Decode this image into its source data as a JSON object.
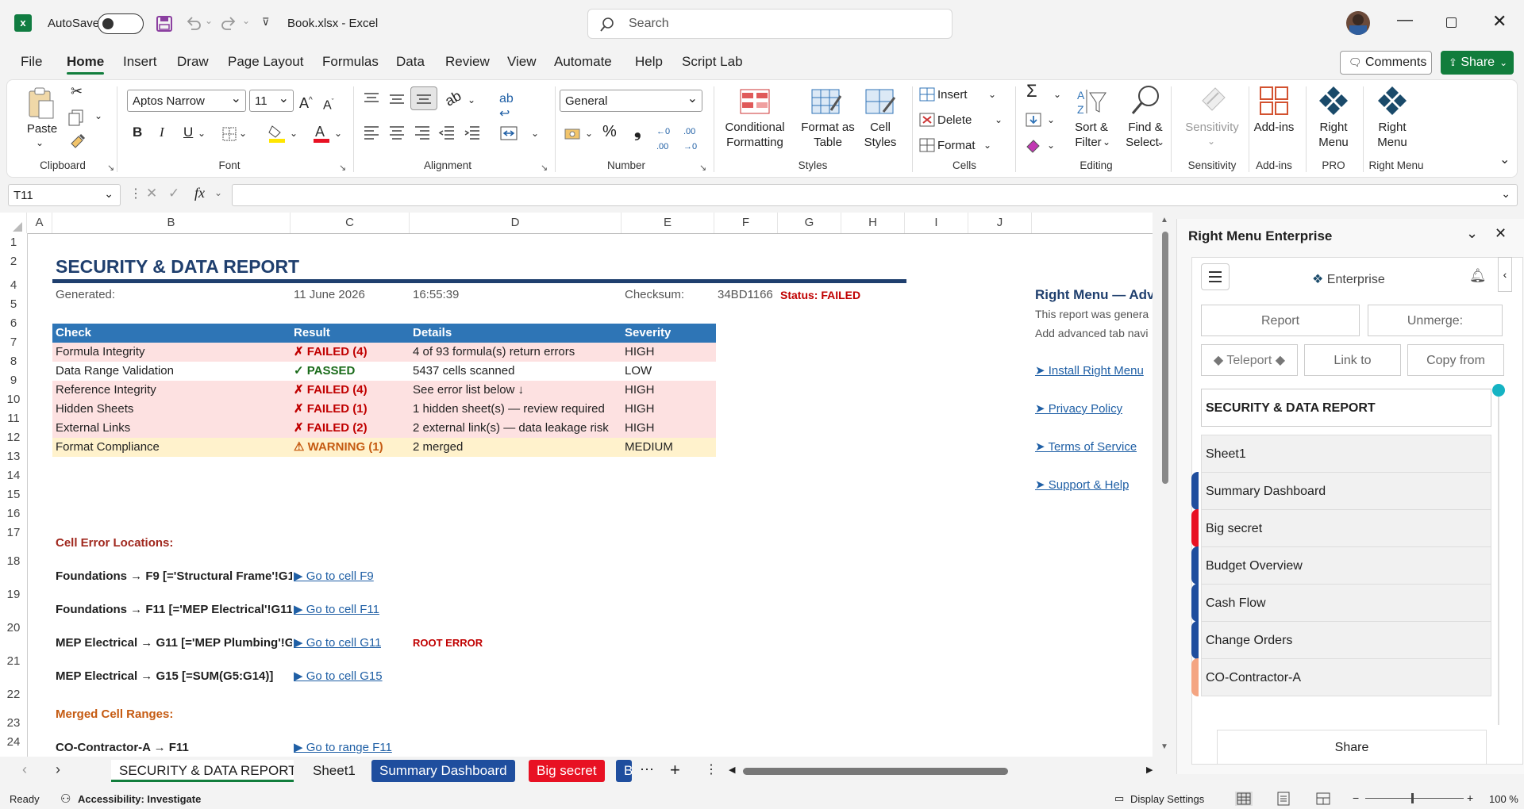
{
  "titlebar": {
    "autosave_label": "AutoSave",
    "autosave_state": "Off",
    "file_title": "Book.xlsx  -  Excel",
    "search_placeholder": "Search"
  },
  "menu_tabs": [
    "File",
    "Home",
    "Insert",
    "Draw",
    "Page Layout",
    "Formulas",
    "Data",
    "Review",
    "View",
    "Automate",
    "Help",
    "Script Lab"
  ],
  "active_tab": "Home",
  "header_buttons": {
    "comments": "Comments",
    "share": "Share"
  },
  "ribbon": {
    "clipboard": {
      "label": "Clipboard",
      "paste": "Paste"
    },
    "font": {
      "label": "Font",
      "font_name": "Aptos Narrow",
      "font_size": "11"
    },
    "alignment": {
      "label": "Alignment"
    },
    "number": {
      "label": "Number",
      "format": "General"
    },
    "styles": {
      "label": "Styles",
      "cond_1": "Conditional",
      "cond_2": "Formatting",
      "fat_1": "Format as",
      "fat_2": "Table",
      "cs_1": "Cell",
      "cs_2": "Styles"
    },
    "cells": {
      "label": "Cells",
      "insert": "Insert",
      "delete": "Delete",
      "format": "Format"
    },
    "editing": {
      "label": "Editing",
      "sort_1": "Sort &",
      "sort_2": "Filter",
      "find_1": "Find &",
      "find_2": "Select"
    },
    "sensitivity": {
      "label": "Sensitivity",
      "btn": "Sensitivity"
    },
    "addins": {
      "label": "Add-ins",
      "btn": "Add-ins"
    },
    "pro": {
      "label": "PRO",
      "btn_1": "Right",
      "btn_2": "Menu"
    },
    "rightmenu": {
      "label": "Right Menu",
      "btn_1": "Right",
      "btn_2": "Menu"
    }
  },
  "formula_bar": {
    "name_box": "T11",
    "formula": ""
  },
  "columns": [
    "A",
    "B",
    "C",
    "D",
    "E",
    "F",
    "G",
    "H",
    "I",
    "J"
  ],
  "rows": [
    "1",
    "2",
    "4",
    "5",
    "6",
    "7",
    "8",
    "9",
    "10",
    "11",
    "12",
    "13",
    "14",
    "15",
    "16",
    "17",
    "18",
    "19",
    "20",
    "21",
    "22",
    "23",
    "24"
  ],
  "report": {
    "title": "SECURITY & DATA REPORT",
    "generated_label": "Generated:",
    "date": "11 June 2026",
    "time": "16:55:39",
    "checksum_label": "Checksum:",
    "checksum": "34BD1166",
    "status": "Status: FAILED",
    "headers": [
      "Check",
      "Result",
      "Details",
      "Severity"
    ],
    "table": [
      {
        "check": "Formula Integrity",
        "result": "✗ FAILED (4)",
        "details": "4 of 93 formula(s) return errors",
        "severity": "HIGH"
      },
      {
        "check": "Data Range Validation",
        "result": "✓ PASSED",
        "details": "5437 cells scanned",
        "severity": "LOW"
      },
      {
        "check": "Reference Integrity",
        "result": "✗ FAILED (4)",
        "details": "See error list below ↓",
        "severity": "HIGH"
      },
      {
        "check": "Hidden Sheets",
        "result": "✗ FAILED (1)",
        "details": "1 hidden sheet(s) — review required",
        "severity": "HIGH"
      },
      {
        "check": "External Links",
        "result": "✗ FAILED (2)",
        "details": "2 external link(s) — data leakage risk",
        "severity": "HIGH"
      },
      {
        "check": "Format Compliance",
        "result": "⚠ WARNING (1)",
        "details": "2 merged",
        "severity": "MEDIUM"
      }
    ],
    "errors_heading": "Cell Error Locations:",
    "errors": [
      {
        "text": "Foundations → F9 [='Structural Frame'!G1",
        "link": "▶ Go to cell F9",
        "note": ""
      },
      {
        "text": "Foundations → F11 [='MEP Electrical'!G11",
        "link": "▶ Go to cell F11",
        "note": ""
      },
      {
        "text": "MEP Electrical → G11 [='MEP Plumbing'!G",
        "link": "▶ Go to cell G11",
        "note": "ROOT ERROR"
      },
      {
        "text": "MEP Electrical → G15 [=SUM(G5:G14)]",
        "link": "▶ Go to cell G15",
        "note": ""
      }
    ],
    "merged_heading": "Merged Cell Ranges:",
    "merged": [
      {
        "text": "CO-Contractor-A → F11",
        "link": "▶ Go to range F11"
      }
    ],
    "side_title": "Right Menu — Adva",
    "side_line1": "This report was genera",
    "side_line2": "Add advanced tab navi",
    "side_links": [
      "➤ Install Right Menu",
      "➤ Privacy Policy",
      "➤ Terms of Service",
      "➤ Support & Help"
    ]
  },
  "sheet_tabs": [
    {
      "name": "SECURITY & DATA REPORT",
      "active": true,
      "color": ""
    },
    {
      "name": "Sheet1",
      "active": false,
      "color": ""
    },
    {
      "name": "Summary Dashboard",
      "active": false,
      "color": "#1f4e9e"
    },
    {
      "name": "Big secret",
      "active": false,
      "color": "#e81123"
    },
    {
      "name": "B",
      "active": false,
      "color": "#1f4e9e"
    }
  ],
  "status_bar": {
    "ready": "Ready",
    "accessibility": "Accessibility: Investigate",
    "display_settings": "Display Settings",
    "zoom": "100 %",
    "zoom_minus": "−",
    "zoom_plus": "+"
  },
  "pane": {
    "title": "Right Menu Enterprise",
    "brand": "Enterprise",
    "buttons_row1": [
      "Report",
      "Unmerge:"
    ],
    "buttons_row2": [
      "◆ Teleport ◆",
      "Link to",
      "Copy from"
    ],
    "search_value": "SECURITY & DATA REPORT",
    "items": [
      {
        "name": "Sheet1",
        "color": ""
      },
      {
        "name": "Summary Dashboard",
        "color": "#1f4e9e"
      },
      {
        "name": "Big secret",
        "color": "#e81123"
      },
      {
        "name": "Budget Overview",
        "color": "#1f4e9e"
      },
      {
        "name": "Cash Flow",
        "color": "#1f4e9e"
      },
      {
        "name": "Change Orders",
        "color": "#1f4e9e"
      },
      {
        "name": "CO-Contractor-A",
        "color": "#f4a582"
      }
    ],
    "share": "Share"
  }
}
